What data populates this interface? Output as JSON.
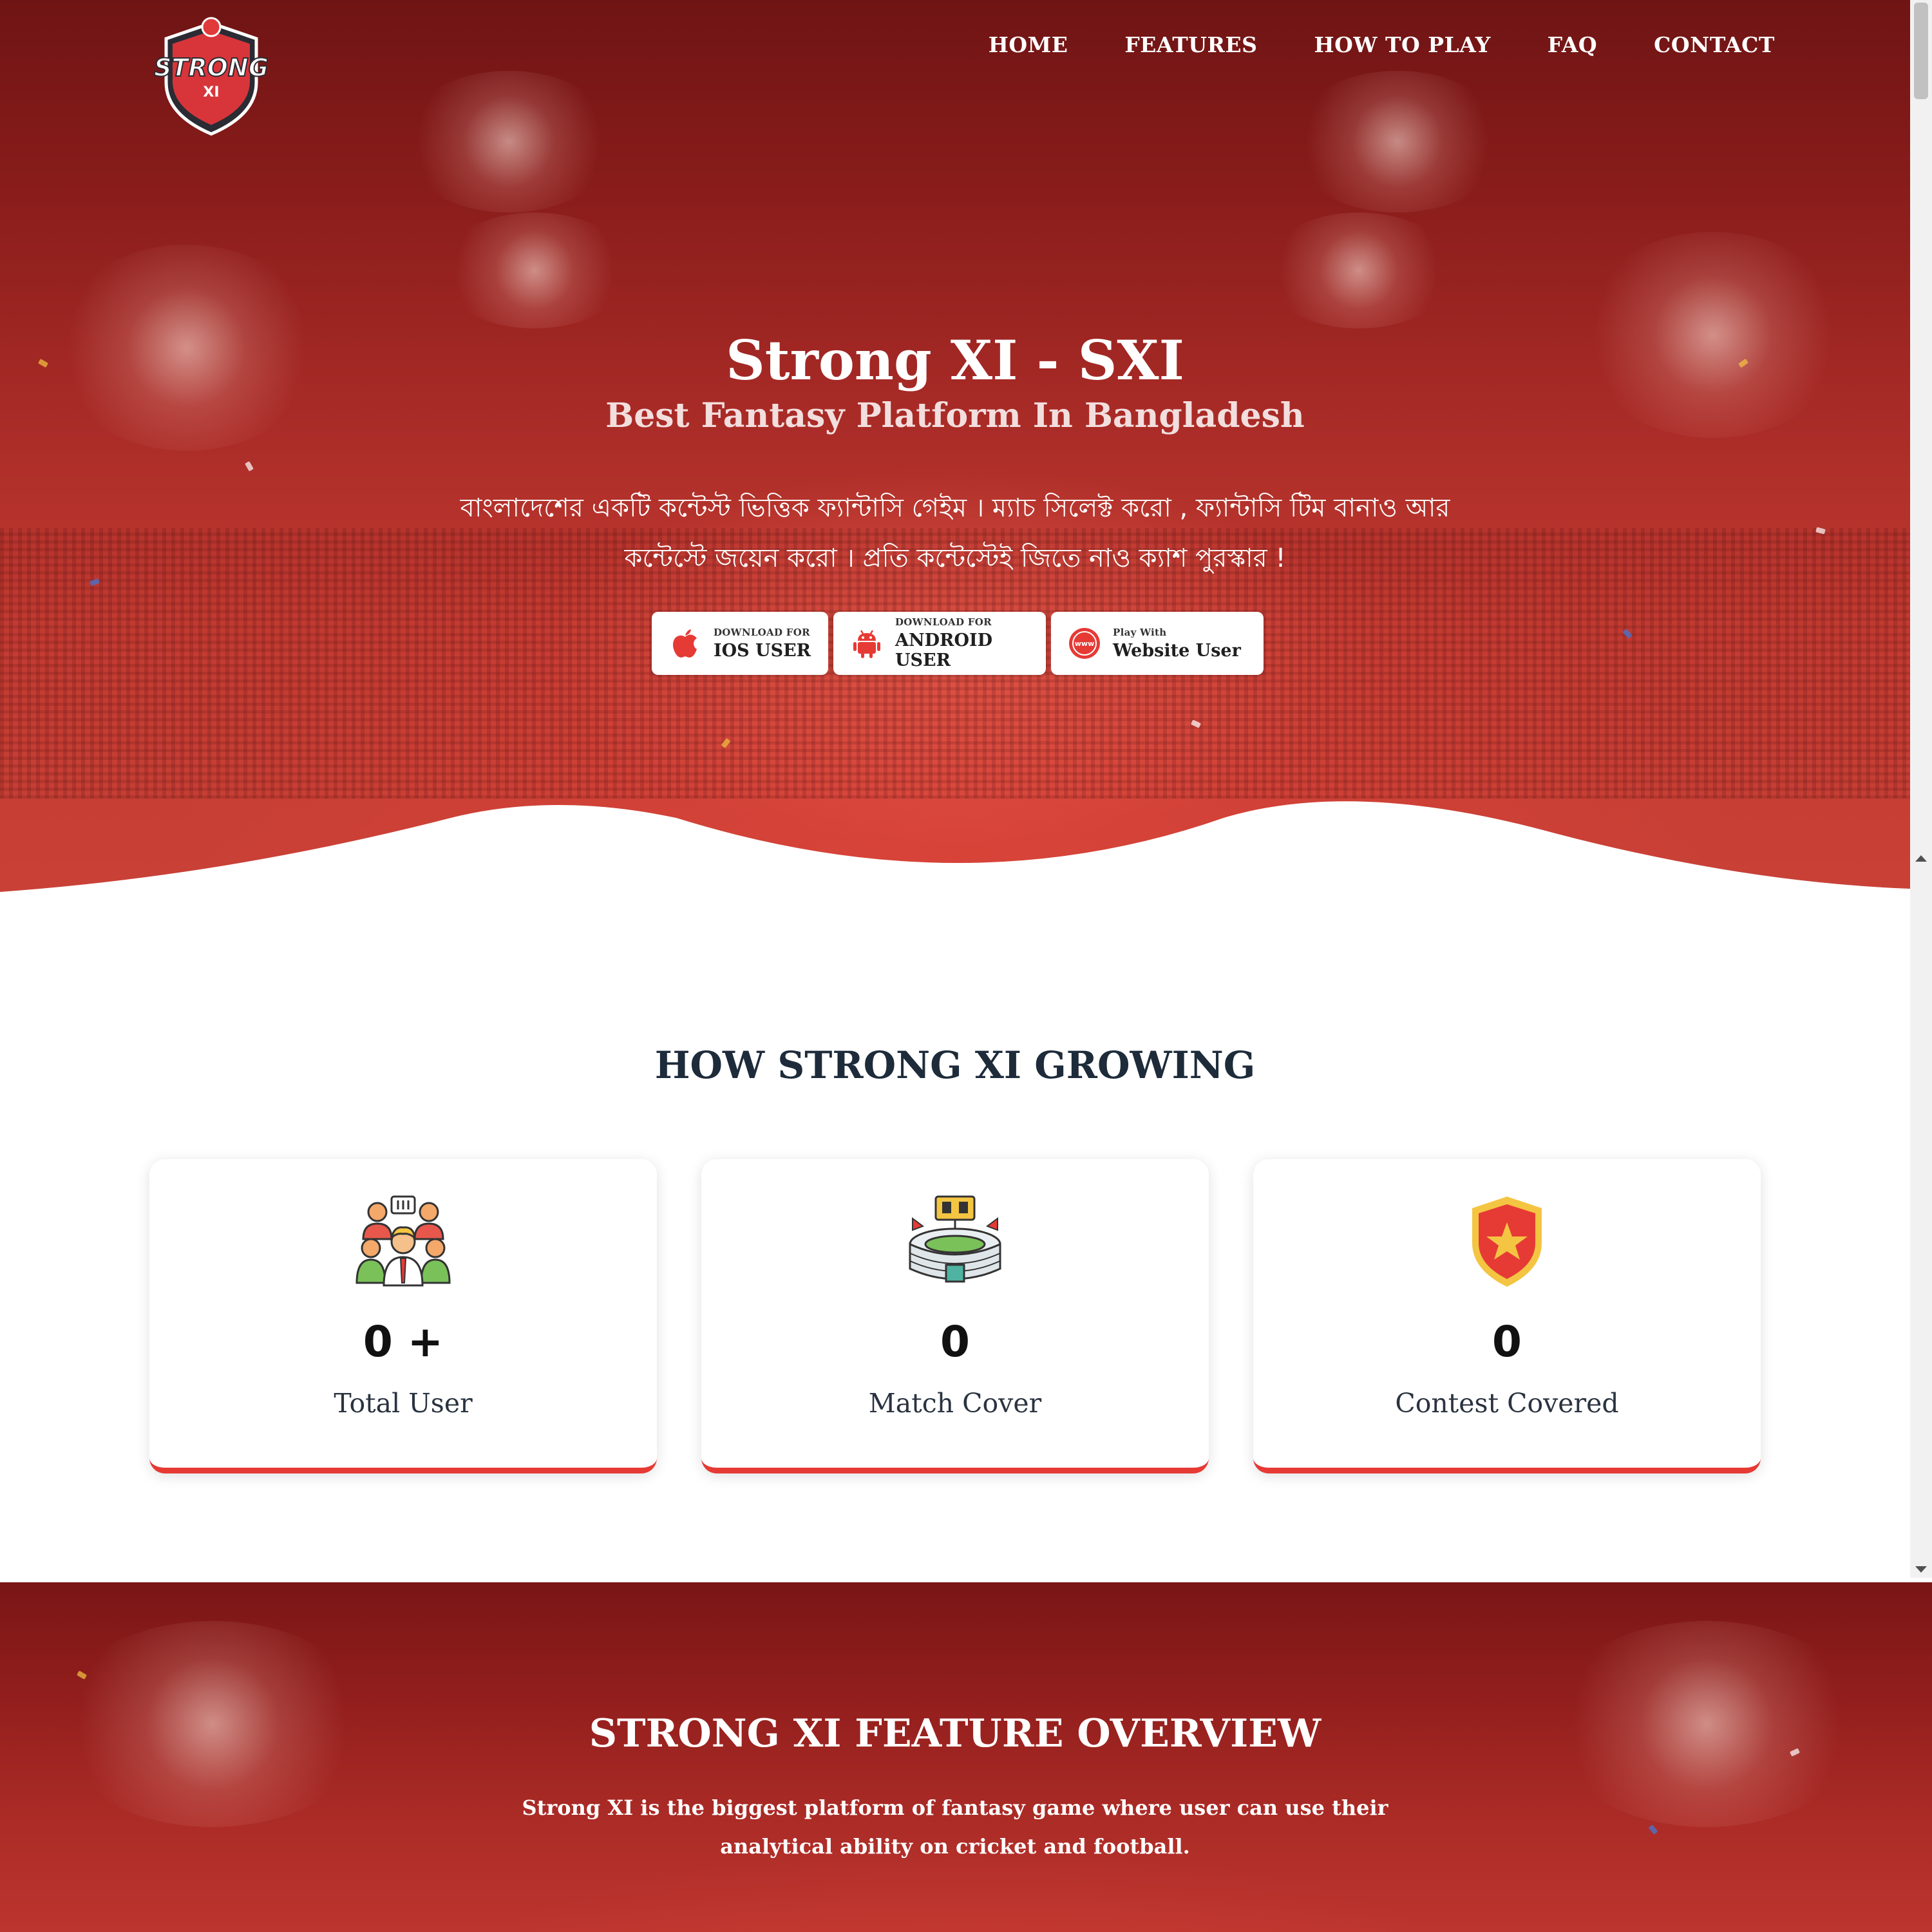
{
  "brand": {
    "name": "Strong XI",
    "logo_text": "STRONG",
    "logo_sub": "XI"
  },
  "nav": {
    "items": [
      "HOME",
      "FEATURES",
      "HOW TO PLAY",
      "FAQ",
      "CONTACT"
    ]
  },
  "hero": {
    "title": "Strong XI - SXI",
    "subtitle": "Best Fantasy Platform In Bangladesh",
    "description_line1": "বাংলাদেশের একটি কন্টেস্ট ভিত্তিক ফ্যান্টাসি গেইম । ম্যাচ সিলেক্ট করো , ফ্যান্টাসি টিম বানাও আর",
    "description_line2": "কন্টেস্টে জয়েন করো । প্রতি কন্টেস্টেই জিতে নাও ক্যাশ পুরস্কার !",
    "buttons": [
      {
        "small": "DOWNLOAD FOR",
        "big": "IOS USER",
        "icon": "apple-icon"
      },
      {
        "small": "DOWNLOAD FOR",
        "big": "ANDROID USER",
        "icon": "android-icon"
      },
      {
        "small": "Play With",
        "big": "Website User",
        "icon": "www-icon"
      }
    ]
  },
  "growing": {
    "title": "HOW STRONG XI GROWING",
    "stats": [
      {
        "value": "0 +",
        "label": "Total User",
        "icon": "users-group-icon"
      },
      {
        "value": "0",
        "label": "Match Cover",
        "icon": "stadium-icon"
      },
      {
        "value": "0",
        "label": "Contest Covered",
        "icon": "shield-star-icon"
      }
    ]
  },
  "features": {
    "title": "STRONG XI FEATURE OVERVIEW",
    "description": "Strong XI is the biggest platform of fantasy game where user can use their analytical ability on cricket and football."
  },
  "colors": {
    "primary_red": "#e63a35",
    "hero_dark": "#6f1414",
    "title_dark": "#1d2b3a"
  }
}
